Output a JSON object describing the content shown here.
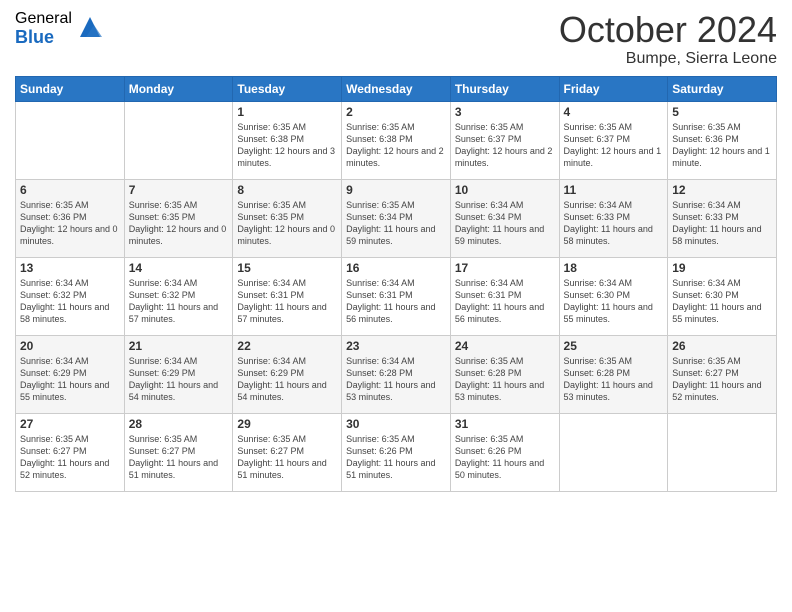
{
  "header": {
    "logo_general": "General",
    "logo_blue": "Blue",
    "month_title": "October 2024",
    "location": "Bumpe, Sierra Leone"
  },
  "weekdays": [
    "Sunday",
    "Monday",
    "Tuesday",
    "Wednesday",
    "Thursday",
    "Friday",
    "Saturday"
  ],
  "rows": [
    [
      {
        "day": "",
        "info": ""
      },
      {
        "day": "",
        "info": ""
      },
      {
        "day": "1",
        "info": "Sunrise: 6:35 AM\nSunset: 6:38 PM\nDaylight: 12 hours and 3 minutes."
      },
      {
        "day": "2",
        "info": "Sunrise: 6:35 AM\nSunset: 6:38 PM\nDaylight: 12 hours and 2 minutes."
      },
      {
        "day": "3",
        "info": "Sunrise: 6:35 AM\nSunset: 6:37 PM\nDaylight: 12 hours and 2 minutes."
      },
      {
        "day": "4",
        "info": "Sunrise: 6:35 AM\nSunset: 6:37 PM\nDaylight: 12 hours and 1 minute."
      },
      {
        "day": "5",
        "info": "Sunrise: 6:35 AM\nSunset: 6:36 PM\nDaylight: 12 hours and 1 minute."
      }
    ],
    [
      {
        "day": "6",
        "info": "Sunrise: 6:35 AM\nSunset: 6:36 PM\nDaylight: 12 hours and 0 minutes."
      },
      {
        "day": "7",
        "info": "Sunrise: 6:35 AM\nSunset: 6:35 PM\nDaylight: 12 hours and 0 minutes."
      },
      {
        "day": "8",
        "info": "Sunrise: 6:35 AM\nSunset: 6:35 PM\nDaylight: 12 hours and 0 minutes."
      },
      {
        "day": "9",
        "info": "Sunrise: 6:35 AM\nSunset: 6:34 PM\nDaylight: 11 hours and 59 minutes."
      },
      {
        "day": "10",
        "info": "Sunrise: 6:34 AM\nSunset: 6:34 PM\nDaylight: 11 hours and 59 minutes."
      },
      {
        "day": "11",
        "info": "Sunrise: 6:34 AM\nSunset: 6:33 PM\nDaylight: 11 hours and 58 minutes."
      },
      {
        "day": "12",
        "info": "Sunrise: 6:34 AM\nSunset: 6:33 PM\nDaylight: 11 hours and 58 minutes."
      }
    ],
    [
      {
        "day": "13",
        "info": "Sunrise: 6:34 AM\nSunset: 6:32 PM\nDaylight: 11 hours and 58 minutes."
      },
      {
        "day": "14",
        "info": "Sunrise: 6:34 AM\nSunset: 6:32 PM\nDaylight: 11 hours and 57 minutes."
      },
      {
        "day": "15",
        "info": "Sunrise: 6:34 AM\nSunset: 6:31 PM\nDaylight: 11 hours and 57 minutes."
      },
      {
        "day": "16",
        "info": "Sunrise: 6:34 AM\nSunset: 6:31 PM\nDaylight: 11 hours and 56 minutes."
      },
      {
        "day": "17",
        "info": "Sunrise: 6:34 AM\nSunset: 6:31 PM\nDaylight: 11 hours and 56 minutes."
      },
      {
        "day": "18",
        "info": "Sunrise: 6:34 AM\nSunset: 6:30 PM\nDaylight: 11 hours and 55 minutes."
      },
      {
        "day": "19",
        "info": "Sunrise: 6:34 AM\nSunset: 6:30 PM\nDaylight: 11 hours and 55 minutes."
      }
    ],
    [
      {
        "day": "20",
        "info": "Sunrise: 6:34 AM\nSunset: 6:29 PM\nDaylight: 11 hours and 55 minutes."
      },
      {
        "day": "21",
        "info": "Sunrise: 6:34 AM\nSunset: 6:29 PM\nDaylight: 11 hours and 54 minutes."
      },
      {
        "day": "22",
        "info": "Sunrise: 6:34 AM\nSunset: 6:29 PM\nDaylight: 11 hours and 54 minutes."
      },
      {
        "day": "23",
        "info": "Sunrise: 6:34 AM\nSunset: 6:28 PM\nDaylight: 11 hours and 53 minutes."
      },
      {
        "day": "24",
        "info": "Sunrise: 6:35 AM\nSunset: 6:28 PM\nDaylight: 11 hours and 53 minutes."
      },
      {
        "day": "25",
        "info": "Sunrise: 6:35 AM\nSunset: 6:28 PM\nDaylight: 11 hours and 53 minutes."
      },
      {
        "day": "26",
        "info": "Sunrise: 6:35 AM\nSunset: 6:27 PM\nDaylight: 11 hours and 52 minutes."
      }
    ],
    [
      {
        "day": "27",
        "info": "Sunrise: 6:35 AM\nSunset: 6:27 PM\nDaylight: 11 hours and 52 minutes."
      },
      {
        "day": "28",
        "info": "Sunrise: 6:35 AM\nSunset: 6:27 PM\nDaylight: 11 hours and 51 minutes."
      },
      {
        "day": "29",
        "info": "Sunrise: 6:35 AM\nSunset: 6:27 PM\nDaylight: 11 hours and 51 minutes."
      },
      {
        "day": "30",
        "info": "Sunrise: 6:35 AM\nSunset: 6:26 PM\nDaylight: 11 hours and 51 minutes."
      },
      {
        "day": "31",
        "info": "Sunrise: 6:35 AM\nSunset: 6:26 PM\nDaylight: 11 hours and 50 minutes."
      },
      {
        "day": "",
        "info": ""
      },
      {
        "day": "",
        "info": ""
      }
    ]
  ]
}
